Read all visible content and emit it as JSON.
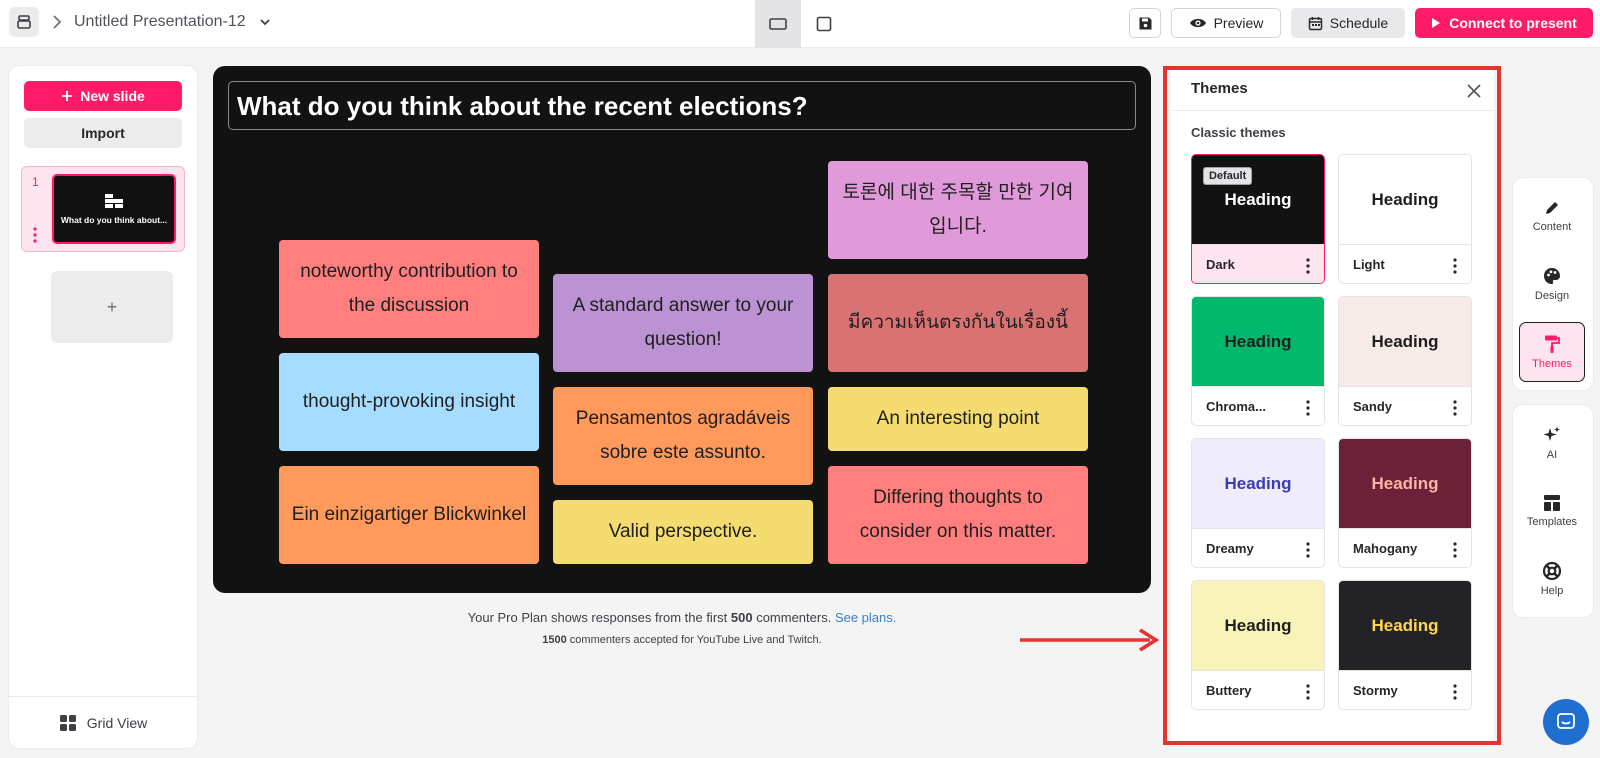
{
  "header": {
    "title": "Untitled Presentation-12",
    "save_icon": "floppy-disk-icon",
    "preview_label": "Preview",
    "schedule_label": "Schedule",
    "connect_label": "Connect to present"
  },
  "sidebar": {
    "new_slide_label": "New slide",
    "import_label": "Import",
    "slides": [
      {
        "number": "1",
        "thumb_text": "What do you think about..."
      }
    ],
    "add_slide_label": "+",
    "grid_view_label": "Grid View"
  },
  "slide": {
    "title": "What do you think about the recent elections?",
    "cards": [
      {
        "text": "noteworthy contribution to the discussion",
        "color": "#ff7f7f"
      },
      {
        "text": "thought-provoking insight",
        "color": "#a6dcff"
      },
      {
        "text": "Ein einzigartiger Blickwinkel",
        "color": "#ff9a5c"
      },
      {
        "text": "A standard answer to your question!",
        "color": "#bb93d3"
      },
      {
        "text": "Pensamentos agradáveis sobre este assunto.",
        "color": "#ff9a5c"
      },
      {
        "text": "Valid perspective.",
        "color": "#f4dc70"
      },
      {
        "text": "토론에 대한 주목할 만한 기여입니다.",
        "color": "#e19ad9"
      },
      {
        "text": "มีความเห็นตรงกันในเรื่องนี้",
        "color": "#d97373"
      },
      {
        "text": "An interesting point",
        "color": "#f4dc70"
      },
      {
        "text": "Differing thoughts to consider on this matter.",
        "color": "#ff7f7f"
      }
    ]
  },
  "notice": {
    "line1_prefix": "Your Pro Plan shows responses from the first ",
    "line1_count": "500",
    "line1_suffix": " commenters. ",
    "line1_link": "See plans.",
    "line2_count": "1500",
    "line2_suffix": " commenters accepted for YouTube Live and Twitch."
  },
  "themes_panel": {
    "title": "Themes",
    "section_label": "Classic themes",
    "default_badge": "Default",
    "themes": [
      {
        "name": "Dark",
        "heading": "Heading",
        "bg": "#121212",
        "fg": "#ffffff",
        "selected": true
      },
      {
        "name": "Light",
        "heading": "Heading",
        "bg": "#ffffff",
        "fg": "#1f1f1f",
        "selected": false
      },
      {
        "name": "Chroma...",
        "heading": "Heading",
        "bg": "#00b86b",
        "fg": "#1f1f1f",
        "selected": false
      },
      {
        "name": "Sandy",
        "heading": "Heading",
        "bg": "#f6ebe6",
        "fg": "#1f1f1f",
        "selected": false
      },
      {
        "name": "Dreamy",
        "heading": "Heading",
        "bg": "#efedfb",
        "fg": "#3b3bb5",
        "selected": false
      },
      {
        "name": "Mahogany",
        "heading": "Heading",
        "bg": "#6b2238",
        "fg": "#ffb3a6",
        "selected": false
      },
      {
        "name": "Buttery",
        "heading": "Heading",
        "bg": "#f8f3b8",
        "fg": "#1f1f1f",
        "selected": false
      },
      {
        "name": "Stormy",
        "heading": "Heading",
        "bg": "#232326",
        "fg": "#ffd84a",
        "selected": false
      }
    ]
  },
  "right_rail": {
    "content_label": "Content",
    "design_label": "Design",
    "themes_label": "Themes",
    "ai_label": "AI",
    "templates_label": "Templates",
    "help_label": "Help"
  },
  "colors": {
    "brand": "#ff1a6a",
    "highlight_outline": "#e5342f",
    "chat": "#1f6fd1"
  }
}
